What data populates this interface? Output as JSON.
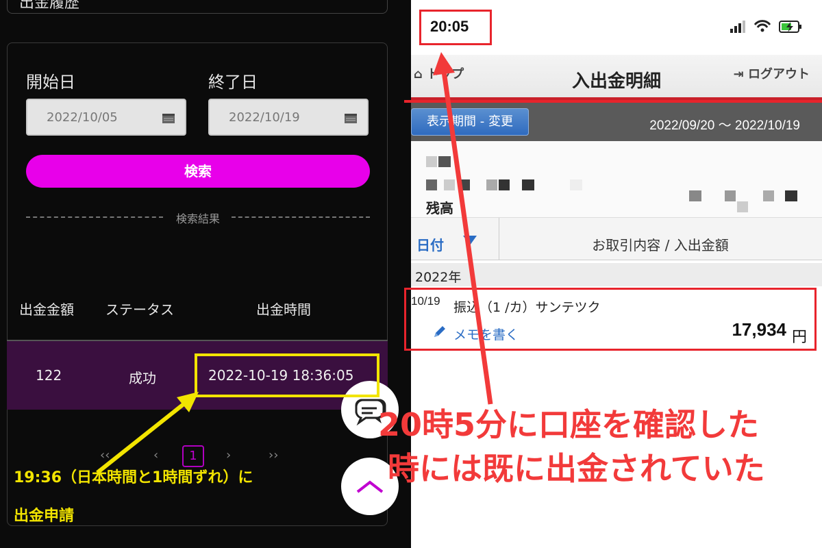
{
  "left": {
    "top_card_label": "出金履歴",
    "start_label": "開始日",
    "end_label": "終了日",
    "start_date": "2022/10/05",
    "end_date": "2022/10/19",
    "search_button": "検索",
    "results_divider": "検索結果",
    "columns": [
      "出金金額",
      "ステータス",
      "出金時間"
    ],
    "row": {
      "amount": "122",
      "status": "成功",
      "time": "2022-10-19 18:36:05"
    },
    "pagination": {
      "first": "‹‹",
      "prev": "‹",
      "current": "1",
      "next": "›",
      "last": "››"
    },
    "icons": [
      "calendar-icon",
      "chat-icon",
      "scroll-up-icon"
    ]
  },
  "right": {
    "status_time": "20:05",
    "nav_top": "トップ",
    "nav_title": "入出金明細",
    "nav_logout": "ログアウト",
    "period_button": "表示期間 - 変更",
    "period_range": "2022/09/20 ～ 2022/10/19",
    "balance_label": "残高",
    "col_date": "日付",
    "col_content": "お取引内容 / 入出金額",
    "year": "2022年",
    "transaction": {
      "date": "10/19",
      "description": "振込（1 /カ）サンテツク",
      "memo_link": "メモを書く",
      "amount": "17,934",
      "currency": "円"
    }
  },
  "annotations": {
    "red_line1": "20時5分に口座を確認した",
    "red_line2": "時には既に出金されていた",
    "yellow_line1": "19:36（日本時間と1時間ずれ）に",
    "yellow_line2": "出金申請",
    "red_color": "#f23a3a",
    "yellow_color": "#f2e400"
  }
}
